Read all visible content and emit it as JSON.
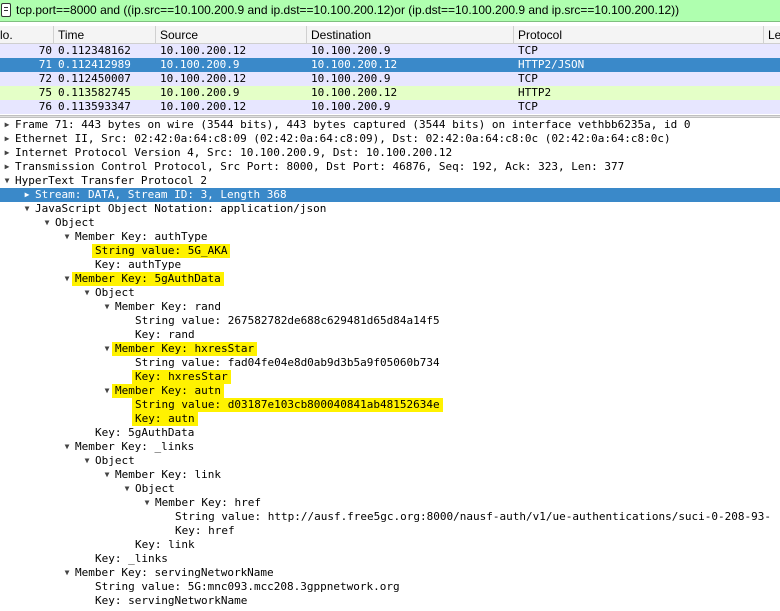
{
  "filter": {
    "text": "tcp.port==8000 and ((ip.src==10.100.200.9 and ip.dst==10.100.200.12)or (ip.dst==10.100.200.9 and ip.src==10.100.200.12))",
    "bg": "#afffaf"
  },
  "columns": [
    "lo.",
    "Time",
    "Source",
    "Destination",
    "Protocol",
    "Le"
  ],
  "packets": [
    {
      "no": "70",
      "time": "0.112348162",
      "src": "10.100.200.12",
      "dst": "10.100.200.9",
      "proto": "TCP",
      "bg": "#e7e6ff",
      "fg": "#000000"
    },
    {
      "no": "71",
      "time": "0.112412989",
      "src": "10.100.200.9",
      "dst": "10.100.200.12",
      "proto": "HTTP2/JSON",
      "bg": "#3a89c9",
      "fg": "#ffffff"
    },
    {
      "no": "72",
      "time": "0.112450007",
      "src": "10.100.200.12",
      "dst": "10.100.200.9",
      "proto": "TCP",
      "bg": "#e7e6ff",
      "fg": "#000000"
    },
    {
      "no": "75",
      "time": "0.113582745",
      "src": "10.100.200.9",
      "dst": "10.100.200.12",
      "proto": "HTTP2",
      "bg": "#e4ffc7",
      "fg": "#000000"
    },
    {
      "no": "76",
      "time": "0.113593347",
      "src": "10.100.200.12",
      "dst": "10.100.200.9",
      "proto": "TCP",
      "bg": "#e7e6ff",
      "fg": "#000000"
    }
  ],
  "tree": [
    {
      "level": 0,
      "arrow": "collapsed",
      "text": "Frame 71: 443 bytes on wire (3544 bits), 443 bytes captured (3544 bits) on interface vethbb6235a, id 0"
    },
    {
      "level": 0,
      "arrow": "collapsed",
      "text": "Ethernet II, Src: 02:42:0a:64:c8:09 (02:42:0a:64:c8:09), Dst: 02:42:0a:64:c8:0c (02:42:0a:64:c8:0c)"
    },
    {
      "level": 0,
      "arrow": "collapsed",
      "text": "Internet Protocol Version 4, Src: 10.100.200.9, Dst: 10.100.200.12"
    },
    {
      "level": 0,
      "arrow": "collapsed",
      "text": "Transmission Control Protocol, Src Port: 8000, Dst Port: 46876, Seq: 192, Ack: 323, Len: 377"
    },
    {
      "level": 0,
      "arrow": "expanded",
      "text": "HyperText Transfer Protocol 2"
    },
    {
      "level": 1,
      "arrow": "collapsed",
      "text": "Stream: DATA, Stream ID: 3, Length 368",
      "selected": true
    },
    {
      "level": 1,
      "arrow": "expanded",
      "text": "JavaScript Object Notation: application/json"
    },
    {
      "level": 2,
      "arrow": "expanded",
      "text": "Object"
    },
    {
      "level": 3,
      "arrow": "expanded",
      "text": "Member Key: authType"
    },
    {
      "level": 4,
      "arrow": "none",
      "text": "String value: 5G_AKA",
      "highlight": true
    },
    {
      "level": 4,
      "arrow": "none",
      "text": "Key: authType"
    },
    {
      "level": 3,
      "arrow": "expanded",
      "text": "Member Key: 5gAuthData",
      "highlight": true
    },
    {
      "level": 4,
      "arrow": "expanded",
      "text": "Object"
    },
    {
      "level": 5,
      "arrow": "expanded",
      "text": "Member Key: rand"
    },
    {
      "level": 6,
      "arrow": "none",
      "text": "String value: 267582782de688c629481d65d84a14f5"
    },
    {
      "level": 6,
      "arrow": "none",
      "text": "Key: rand"
    },
    {
      "level": 5,
      "arrow": "expanded",
      "text": "Member Key: hxresStar",
      "highlight": true
    },
    {
      "level": 6,
      "arrow": "none",
      "text": "String value: fad04fe04e8d0ab9d3b5a9f05060b734"
    },
    {
      "level": 6,
      "arrow": "none",
      "text": "Key: hxresStar",
      "highlight": true
    },
    {
      "level": 5,
      "arrow": "expanded",
      "text": "Member Key: autn",
      "highlight": true
    },
    {
      "level": 6,
      "arrow": "none",
      "text": "String value: d03187e103cb800040841ab48152634e",
      "highlight": true
    },
    {
      "level": 6,
      "arrow": "none",
      "text": "Key: autn",
      "highlight": true
    },
    {
      "level": 4,
      "arrow": "none",
      "text": "Key: 5gAuthData"
    },
    {
      "level": 3,
      "arrow": "expanded",
      "text": "Member Key: _links"
    },
    {
      "level": 4,
      "arrow": "expanded",
      "text": "Object"
    },
    {
      "level": 5,
      "arrow": "expanded",
      "text": "Member Key: link"
    },
    {
      "level": 6,
      "arrow": "expanded",
      "text": "Object"
    },
    {
      "level": 7,
      "arrow": "expanded",
      "text": "Member Key: href"
    },
    {
      "level": 8,
      "arrow": "none",
      "text": "String value: http://ausf.free5gc.org:8000/nausf-auth/v1/ue-authentications/suci-0-208-93-"
    },
    {
      "level": 8,
      "arrow": "none",
      "text": "Key: href"
    },
    {
      "level": 6,
      "arrow": "none",
      "text": "Key: link"
    },
    {
      "level": 4,
      "arrow": "none",
      "text": "Key: _links"
    },
    {
      "level": 3,
      "arrow": "expanded",
      "text": "Member Key: servingNetworkName"
    },
    {
      "level": 4,
      "arrow": "none",
      "text": "String value: 5G:mnc093.mcc208.3gppnetwork.org"
    },
    {
      "level": 4,
      "arrow": "none",
      "text": "Key: servingNetworkName"
    }
  ],
  "colors": {
    "selected": "#3a89c9",
    "highlight": "#fff200",
    "tcp_row": "#e7e6ff",
    "http2_row": "#e4ffc7"
  },
  "icons": {
    "filter": "bookmark-filter-icon",
    "collapsed": "triangle-right-icon",
    "expanded": "triangle-down-icon"
  }
}
